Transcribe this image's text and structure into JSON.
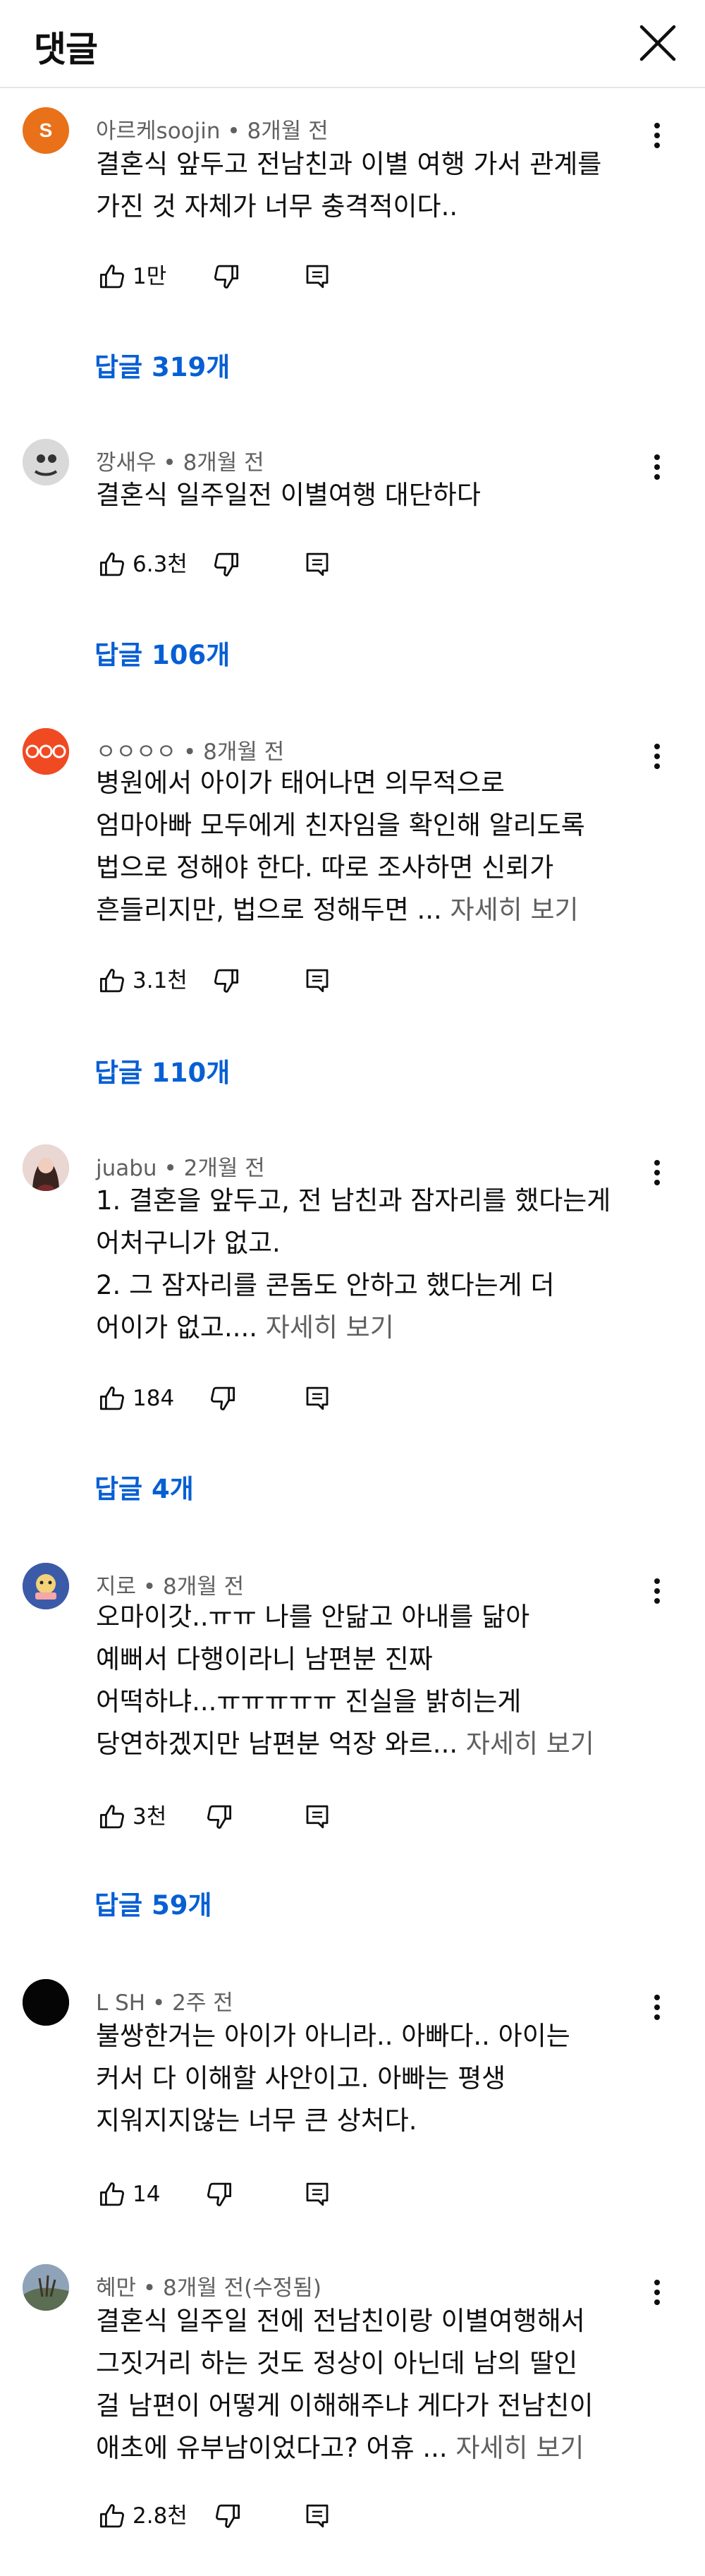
{
  "header": {
    "title": "댓글"
  },
  "comments": [
    {
      "author": "아르케soojin",
      "time": "8개월 전",
      "avatar_letter": "S",
      "avatar_color": "#e8711a",
      "lines": [
        "결혼식 앞두고 전남친과 이별 여행 가서 관계를",
        "가진 것 자체가 너무 충격적이다.."
      ],
      "more": "",
      "likes": "1만",
      "replies": "답글 319개"
    },
    {
      "author": "깡새우",
      "time": "8개월 전",
      "avatar_letter": "",
      "avatar_color": "#d9d9d9",
      "lines": [
        "결혼식 일주일전 이별여행  대단하다"
      ],
      "more": "",
      "likes": "6.3천",
      "replies": "답글 106개"
    },
    {
      "author": "ㅇㅇㅇㅇ",
      "time": "8개월 전",
      "avatar_letter": "",
      "avatar_color": "#f04a23",
      "lines": [
        "병원에서 아이가 태어나면 의무적으로",
        "엄마아빠 모두에게 친자임을 확인해 알리도록",
        "법으로 정해야 한다. 따로 조사하면 신뢰가",
        "흔들리지만, 법으로 정해두면 ... "
      ],
      "more": "자세히 보기",
      "likes": "3.1천",
      "replies": "답글 110개"
    },
    {
      "author": "juabu",
      "time": "2개월 전",
      "avatar_letter": "",
      "avatar_color": "#c9a9a6",
      "lines": [
        "1. 결혼을 앞두고, 전 남친과 잠자리를 했다는게",
        "어처구니가 없고.",
        "2. 그 잠자리를 콘돔도 안하고 했다는게 더",
        "어이가 없고.... "
      ],
      "more": "자세히 보기",
      "likes": "184",
      "replies": "답글 4개"
    },
    {
      "author": "지로",
      "time": "8개월 전",
      "avatar_letter": "",
      "avatar_color": "#3b5ba9",
      "lines": [
        "오마이갓..ㅠㅠ 나를 안닮고 아내를 닮아",
        "예뻐서 다행이라니 남편분 진짜",
        "어떡하냐...ㅠㅠㅠㅠㅠ 진실을 밝히는게",
        "당연하겠지만 남편분 억장 와르... "
      ],
      "more": "자세히 보기",
      "likes": "3천",
      "replies": "답글 59개"
    },
    {
      "author": "L SH",
      "time": "2주 전",
      "avatar_letter": "",
      "avatar_color": "#050505",
      "lines": [
        "불쌍한거는 아이가 아니라.. 아빠다..    아이는",
        "커서 다 이해할 사안이고. 아빠는 평생",
        "지워지지않는 너무 큰 상처다."
      ],
      "more": "",
      "likes": "14",
      "replies": ""
    },
    {
      "author": "혜만",
      "time": "8개월 전(수정됨)",
      "avatar_letter": "",
      "avatar_color": "#8fa3b8",
      "lines": [
        "결혼식 일주일 전에 전남친이랑 이별여행해서",
        "그짓거리 하는 것도 정상이 아닌데 남의 딸인",
        "걸 남편이 어떻게 이해해주냐 게다가 전남친이",
        "애초에 유부남이었다고? 어휴 ... "
      ],
      "more": "자세히 보기",
      "likes": "2.8천",
      "replies": ""
    }
  ]
}
